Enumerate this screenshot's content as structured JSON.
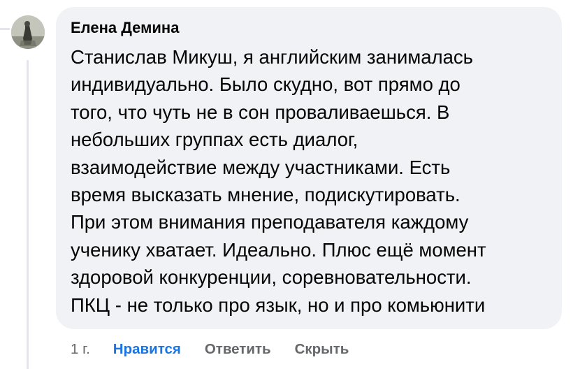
{
  "comment": {
    "author": "Елена Демина",
    "lines": [
      "Станислав Микуш, я английским занималась",
      "индивидуально. Было скудно, вот прямо до",
      "того, что чуть не в сон проваливаешься. В",
      "небольших группах есть диалог,",
      "взаимодействие между участниками. Есть",
      "время высказать мнение, подискутировать.",
      "При этом внимания преподавателя каждому",
      "ученику хватает. Идеально. Плюс ещё момент",
      "здоровой конкуренции, соревновательности.",
      "ПКЦ - не только про язык, но и про комьюнити"
    ]
  },
  "actions": {
    "time": "1 г.",
    "like": "Нравится",
    "reply": "Ответить",
    "hide": "Скрыть"
  },
  "colors": {
    "bubble_bg": "#f0f2f5",
    "text": "#050505",
    "muted": "#65676b",
    "like_active": "#1b74e4",
    "thread_line": "#e4e6eb"
  },
  "icons": {
    "avatar": "user-avatar-photo"
  }
}
